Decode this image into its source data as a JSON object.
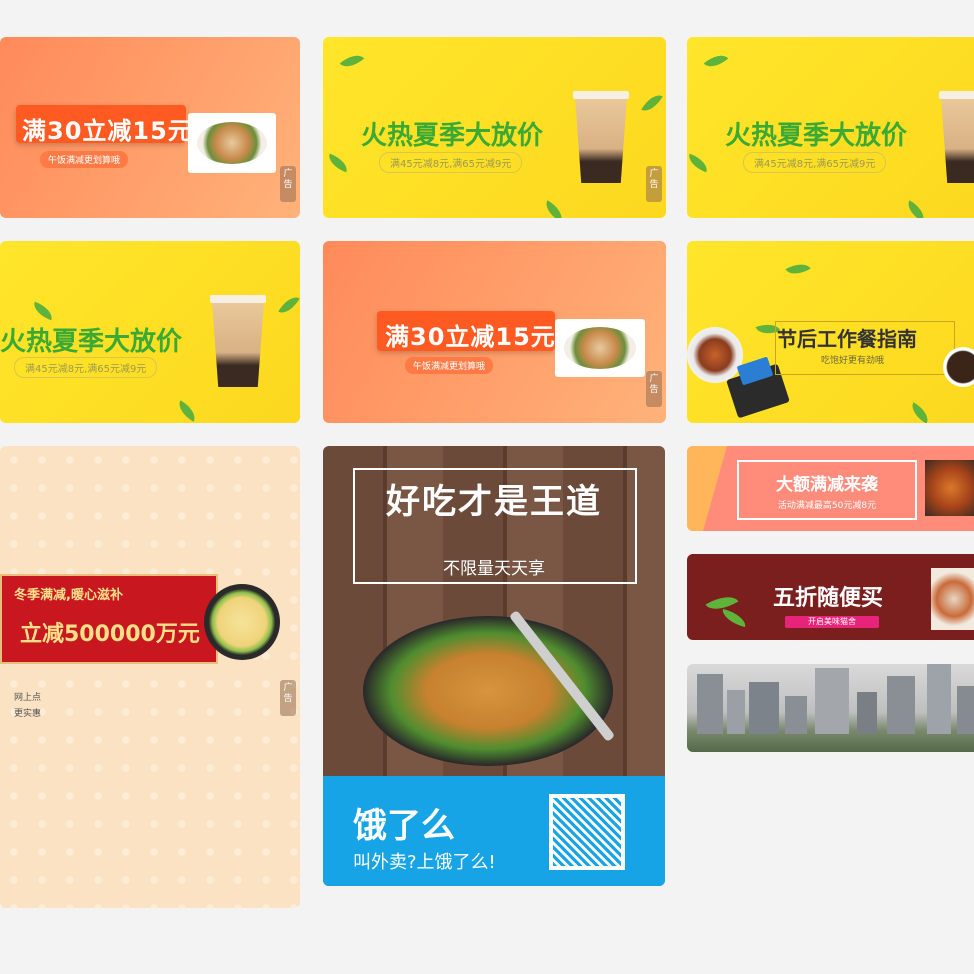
{
  "cards": {
    "promo": {
      "title": "满30立减15元",
      "subtitle": "午饭满减更划算哦",
      "ad": "广告"
    },
    "summer": {
      "title": "火热夏季大放价",
      "subtitle": "满45元减8元,满65元减9元",
      "ad": "广告"
    },
    "guide": {
      "title": "节后工作餐指南",
      "subtitle": "吃饱好更有劲哦"
    },
    "winter": {
      "line1": "冬季满减,暖心滋补",
      "line2": "立减500000万元",
      "note1": "网上点",
      "note2": "更实惠",
      "ad": "广告"
    },
    "eleme": {
      "headline": "好吃才是王道",
      "subline": "不限量天天享",
      "brand": "饿了么",
      "slogan": "叫外卖?上饿了么!"
    },
    "bigsale": {
      "title": "大额满减来袭",
      "subtitle": "活动满减最高50元减8元"
    },
    "halfprice": {
      "title": "五折随便买",
      "button": "开启美味猫舍"
    }
  },
  "colors": {
    "orange": "#ff8a5a",
    "yellow": "#fcd81f",
    "green_text": "#3aaa35",
    "eleme_blue": "#16a4e6",
    "festive_red": "#c8171f"
  }
}
